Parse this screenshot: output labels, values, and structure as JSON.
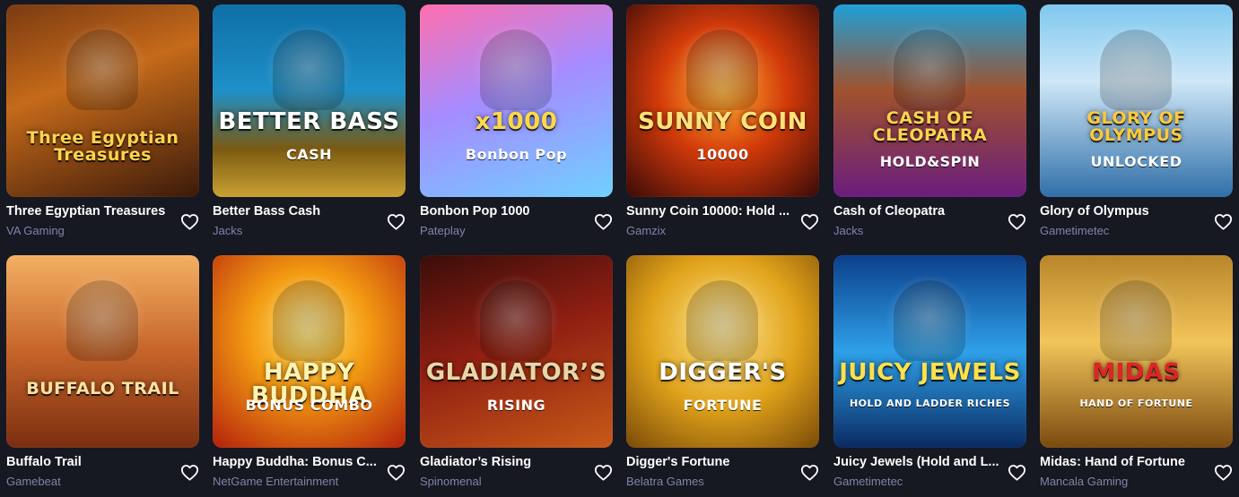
{
  "games": [
    {
      "title": "Three Egyptian Treasures",
      "provider": "VA Gaming",
      "art": "Three Egyptian Treasures",
      "art2": "",
      "bg": "linear-gradient(160deg,#7a3a12 0%,#c56a1a 40%,#3b1a0a 100%)",
      "fg": "#ffd34d"
    },
    {
      "title": "Better Bass Cash",
      "provider": "Jacks",
      "art": "BETTER BASS",
      "art2": "CASH",
      "bg": "linear-gradient(180deg,#0f6ea6 0%,#1e90c8 45%,#7a5a12 75%,#caa132 100%)",
      "fg": "#ffffff"
    },
    {
      "title": "Bonbon Pop 1000",
      "provider": "Pateplay",
      "art": "x1000",
      "art2": "Bonbon Pop",
      "bg": "linear-gradient(160deg,#ff6fae 0%,#a68bff 45%,#6fd0ff 100%)",
      "fg": "#ffd84a"
    },
    {
      "title": "Sunny Coin 10000: Hold ...",
      "provider": "Gamzix",
      "art": "SUNNY COIN",
      "art2": "10000",
      "bg": "radial-gradient(circle at 50% 45%,#ffb02e 0%,#d23a0a 45%,#3a0a08 100%)",
      "fg": "#ffe27a"
    },
    {
      "title": "Cash of Cleopatra",
      "provider": "Jacks",
      "art": "CASH OF CLEOPATRA",
      "art2": "HOLD&SPIN",
      "bg": "linear-gradient(180deg,#1f9fd8 0%,#a0522d 45%,#6a1d7d 100%)",
      "fg": "#ffd34d"
    },
    {
      "title": "Glory of Olympus",
      "provider": "Gametimetec",
      "art": "GLORY OF OLYMPUS",
      "art2": "UNLOCKED",
      "bg": "linear-gradient(180deg,#7fc8ef 0%,#cfe7f7 40%,#2f6fa8 100%)",
      "fg": "#ffc93a"
    },
    {
      "title": "Buffalo Trail",
      "provider": "Gamebeat",
      "art": "BUFFALO TRAIL",
      "art2": "",
      "bg": "linear-gradient(180deg,#f4b063 0%,#c5642a 50%,#7a2e10 100%)",
      "fg": "#ffe2a0"
    },
    {
      "title": "Happy Buddha: Bonus C...",
      "provider": "NetGame Entertainment",
      "art": "HAPPY BUDDHA",
      "art2": "BONUS COMBO",
      "bg": "radial-gradient(circle at 50% 40%,#ffe36a 0%,#f39a12 40%,#b3200c 100%)",
      "fg": "#fff3b0"
    },
    {
      "title": "Gladiator’s Rising",
      "provider": "Spinomenal",
      "art": "GLADIATOR’S",
      "art2": "RISING",
      "bg": "linear-gradient(160deg,#3a0d0a 0%,#8f1e12 45%,#c75a18 100%)",
      "fg": "#e9d6a8"
    },
    {
      "title": "Digger's Fortune",
      "provider": "Belatra Games",
      "art": "DIGGER'S",
      "art2": "FORTUNE",
      "bg": "radial-gradient(circle at 50% 40%,#ffe58a 0%,#e0a21a 50%,#7a4a08 100%)",
      "fg": "#ffffff"
    },
    {
      "title": "Juicy Jewels (Hold and L...",
      "provider": "Gametimetec",
      "art": "JUICY JEWELS",
      "art2": "HOLD AND LADDER RICHES",
      "bg": "linear-gradient(180deg,#0c3f8a 0%,#2ea0e8 50%,#0a2a62 100%)",
      "fg": "#ffe14a"
    },
    {
      "title": "Midas: Hand of Fortune",
      "provider": "Mancala Gaming",
      "art": "MIDAS",
      "art2": "HAND OF FORTUNE",
      "bg": "linear-gradient(180deg,#b8862a 0%,#f2c45a 45%,#7a4a10 100%)",
      "fg": "#e02424"
    }
  ],
  "colors": {
    "background": "#161822",
    "title": "#ffffff",
    "provider": "#7e86a6",
    "heart": "#ffffff"
  },
  "icons": {
    "favorite": "heart-outline-icon"
  }
}
